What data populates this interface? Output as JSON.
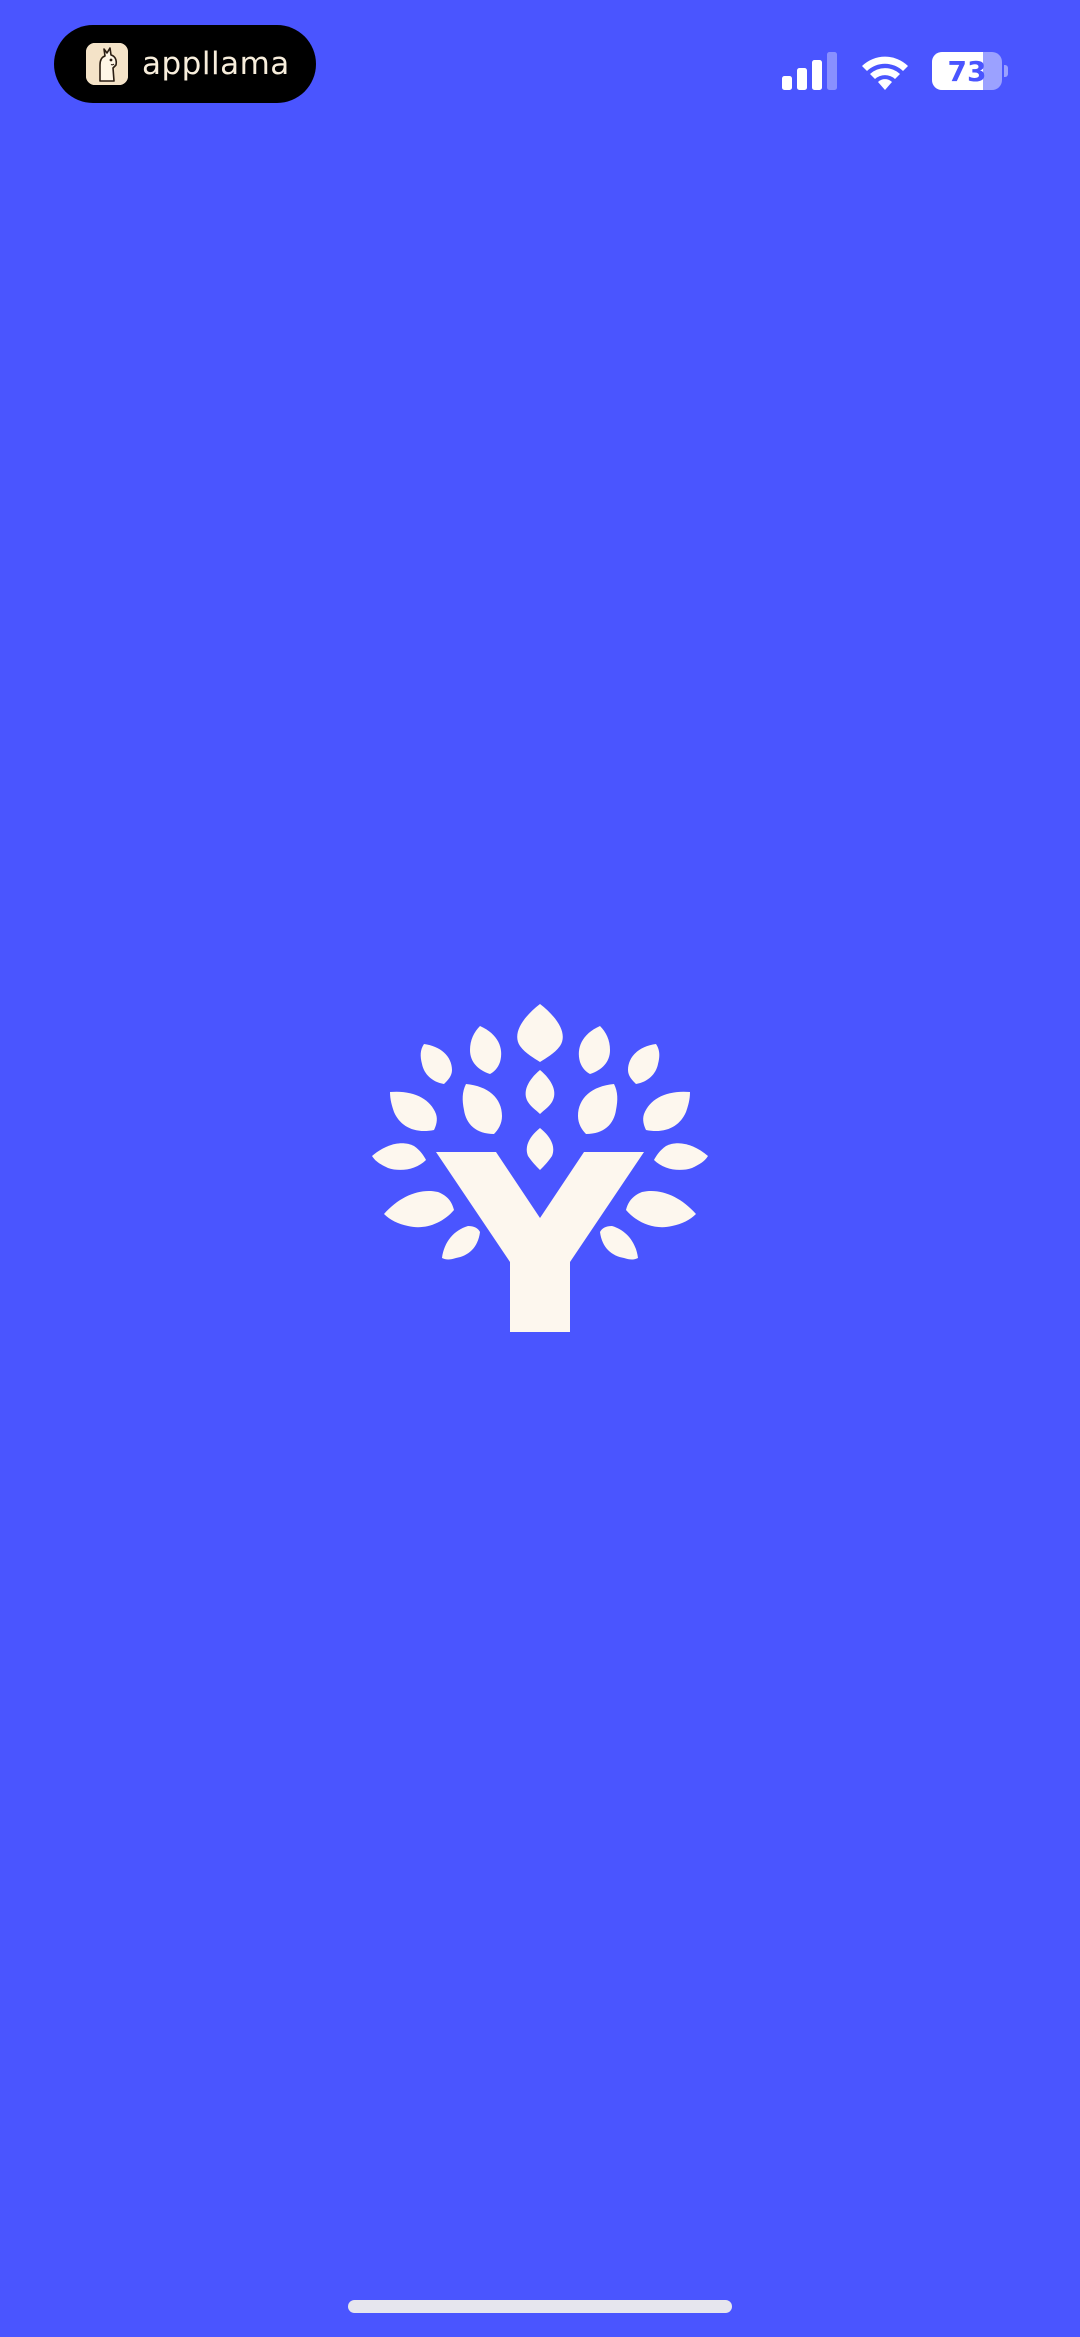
{
  "status_bar": {
    "app_name": "appllama",
    "app_icon": "llama-icon",
    "signal_icon": "cellular-signal-icon",
    "wifi_icon": "wifi-icon",
    "battery_level": "73",
    "battery_fraction": 0.73
  },
  "splash": {
    "logo_icon": "tree-y-logo-icon",
    "logo_color": "#FDF7EE",
    "background_color": "#4A55FF"
  }
}
